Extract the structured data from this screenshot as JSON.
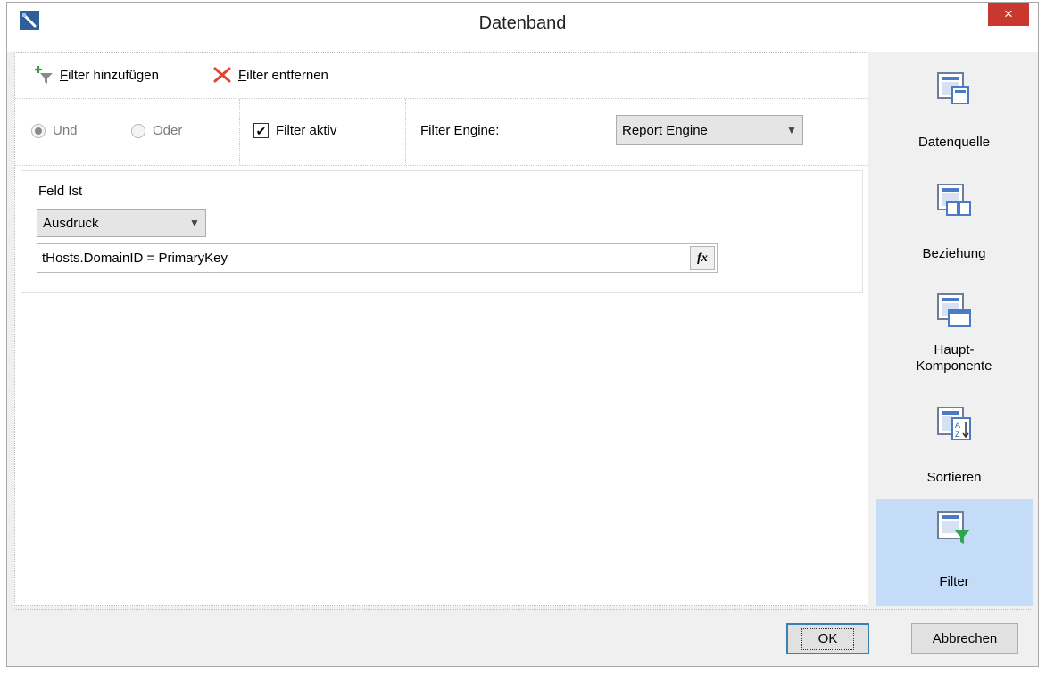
{
  "window": {
    "title": "Datenband",
    "close_label": "×"
  },
  "toolbar": {
    "add_filter_hotkey": "F",
    "add_filter_rest": "ilter hinzufügen",
    "remove_filter_hotkey": "F",
    "remove_filter_rest": "ilter entfernen"
  },
  "options": {
    "and_label": "Und",
    "and_selected": true,
    "or_label": "Oder",
    "or_selected": false,
    "filter_active_label": "Filter aktiv",
    "filter_active_checked": true,
    "filter_engine_label": "Filter Engine:",
    "filter_engine_value": "Report Engine"
  },
  "filter": {
    "field_label": "Feld Ist",
    "type_value": "Ausdruck",
    "expression": "tHosts.DomainID = PrimaryKey",
    "fx_label": "fx"
  },
  "sidebar": {
    "items": [
      {
        "label": "Datenquelle",
        "icon": "datasource-icon",
        "active": false
      },
      {
        "label": "Beziehung",
        "icon": "relation-icon",
        "active": false
      },
      {
        "label": "Haupt-Komponente",
        "line1": "Haupt-",
        "line2": "Komponente",
        "icon": "master-component-icon",
        "active": false
      },
      {
        "label": "Sortieren",
        "icon": "sort-icon",
        "active": false
      },
      {
        "label": "Filter",
        "icon": "filter-icon",
        "active": true
      }
    ]
  },
  "footer": {
    "ok_label": "OK",
    "cancel_label": "Abbrechen"
  },
  "colors": {
    "accent": "#c4dcf8",
    "close": "#c8382f",
    "add": "#3b9c3b",
    "remove": "#e0452d",
    "filter_funnel": "#2aa84a"
  }
}
